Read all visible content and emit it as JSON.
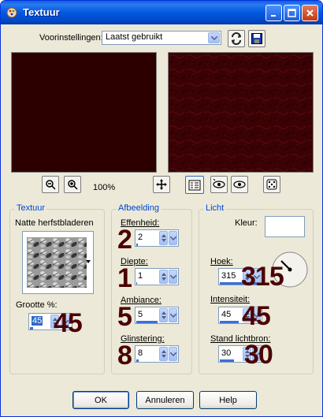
{
  "window": {
    "title": "Textuur"
  },
  "presets": {
    "label": "Voorinstellingen:",
    "selected": "Laatst gebruikt"
  },
  "zoom": {
    "level": "100%"
  },
  "texture_group": {
    "title": "Textuur",
    "texture_name": "Natte herfstbladeren",
    "size_label": "Grootte %:",
    "size_value": "45",
    "size_overlay": "45"
  },
  "image_group": {
    "title": "Afbeelding",
    "smoothness_label": "Effenheid:",
    "smoothness_value": "2",
    "smoothness_overlay": "2",
    "depth_label": "Diepte:",
    "depth_value": "1",
    "depth_overlay": "1",
    "ambiance_label": "Ambiance:",
    "ambiance_value": "5",
    "ambiance_overlay": "5",
    "shine_label": "Glinstering:",
    "shine_value": "8",
    "shine_overlay": "8"
  },
  "light_group": {
    "title": "Licht",
    "color_label": "Kleur:",
    "color_value": "#ffffff",
    "angle_label": "Hoek:",
    "angle_value": "315",
    "angle_overlay": "315",
    "intensity_label": "Intensiteit:",
    "intensity_value": "45",
    "intensity_overlay": "45",
    "elevation_label": "Stand lichtbron:",
    "elevation_value": "30",
    "elevation_overlay": "30"
  },
  "buttons": {
    "ok": "OK",
    "cancel": "Annuleren",
    "help": "Help"
  },
  "colors": {
    "preview_original": "#2d0000",
    "preview_result": "#3a0204",
    "overlay_numbers": "#4b0000",
    "group_title": "#0046d5"
  },
  "icons": [
    "app-icon",
    "minimize-icon",
    "maximize-icon",
    "close-icon",
    "load-preset-icon",
    "save-preset-icon",
    "zoom-out-icon",
    "zoom-in-icon",
    "move-icon",
    "proof-icon",
    "randomize-icon",
    "dice-icon",
    "dropdown-arrow-icon",
    "spin-up-icon",
    "spin-down-icon"
  ]
}
